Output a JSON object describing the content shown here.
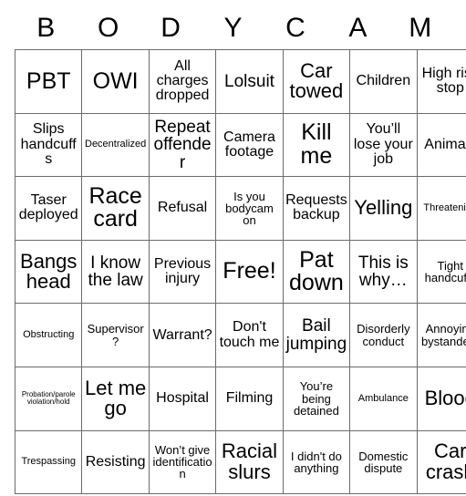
{
  "card": {
    "header_letters": [
      "B",
      "O",
      "D",
      "Y",
      "C",
      "A",
      "M"
    ],
    "free_space_label": "Free!",
    "rows": [
      [
        {
          "text": "PBT",
          "size": "s-xxl"
        },
        {
          "text": "OWI",
          "size": "s-xxl"
        },
        {
          "text": "All charges dropped",
          "size": "s-md"
        },
        {
          "text": "Lolsuit",
          "size": "s-lg"
        },
        {
          "text": "Car towed",
          "size": "s-xl"
        },
        {
          "text": "Children",
          "size": "s-md"
        },
        {
          "text": "High risk stop",
          "size": "s-md"
        }
      ],
      [
        {
          "text": "Slips handcuffs",
          "size": "s-md"
        },
        {
          "text": "Decentralized",
          "size": "s-xs"
        },
        {
          "text": "Repeat offender",
          "size": "s-lg"
        },
        {
          "text": "Camera footage",
          "size": "s-md"
        },
        {
          "text": "Kill me",
          "size": "s-xxl"
        },
        {
          "text": "You’ll lose your job",
          "size": "s-md"
        },
        {
          "text": "Animals",
          "size": "s-md"
        }
      ],
      [
        {
          "text": "Taser deployed",
          "size": "s-md"
        },
        {
          "text": "Race card",
          "size": "s-xxl"
        },
        {
          "text": "Refusal",
          "size": "s-md"
        },
        {
          "text": "Is you bodycam on",
          "size": "s-sm"
        },
        {
          "text": "Requests backup",
          "size": "s-md"
        },
        {
          "text": "Yelling",
          "size": "s-xl"
        },
        {
          "text": "Threatening",
          "size": "s-xs"
        }
      ],
      [
        {
          "text": "Bangs head",
          "size": "s-xl"
        },
        {
          "text": "I know the law",
          "size": "s-lg"
        },
        {
          "text": "Previous injury",
          "size": "s-md"
        },
        {
          "text": "Free!",
          "size": "s-xxl"
        },
        {
          "text": "Pat down",
          "size": "s-xxl"
        },
        {
          "text": "This is why…",
          "size": "s-lg"
        },
        {
          "text": "Tight handcuffs",
          "size": "s-sm"
        }
      ],
      [
        {
          "text": "Obstructing",
          "size": "s-xs"
        },
        {
          "text": "Supervisor?",
          "size": "s-sm"
        },
        {
          "text": "Warrant?",
          "size": "s-md"
        },
        {
          "text": "Don't touch me",
          "size": "s-md"
        },
        {
          "text": "Bail jumping",
          "size": "s-lg"
        },
        {
          "text": "Disorderly conduct",
          "size": "s-sm"
        },
        {
          "text": "Annoying bystanders",
          "size": "s-sm"
        }
      ],
      [
        {
          "text": "Probation/parole violation/hold",
          "size": "s-xxs"
        },
        {
          "text": "Let me go",
          "size": "s-xl"
        },
        {
          "text": "Hospital",
          "size": "s-md"
        },
        {
          "text": "Filming",
          "size": "s-md"
        },
        {
          "text": "You’re being detained",
          "size": "s-sm"
        },
        {
          "text": "Ambulance",
          "size": "s-xs"
        },
        {
          "text": "Blood",
          "size": "s-xl"
        }
      ],
      [
        {
          "text": "Trespassing",
          "size": "s-xs"
        },
        {
          "text": "Resisting",
          "size": "s-md"
        },
        {
          "text": "Won’t give identification",
          "size": "s-sm"
        },
        {
          "text": "Racial slurs",
          "size": "s-xl"
        },
        {
          "text": "I didn't do anything",
          "size": "s-sm"
        },
        {
          "text": "Domestic dispute",
          "size": "s-sm"
        },
        {
          "text": "Car crash",
          "size": "s-xl"
        }
      ]
    ]
  },
  "colors": {
    "background": "#ffffff",
    "cell_background": "#ffffff",
    "border": "#6b6b6b",
    "text": "#000000"
  }
}
